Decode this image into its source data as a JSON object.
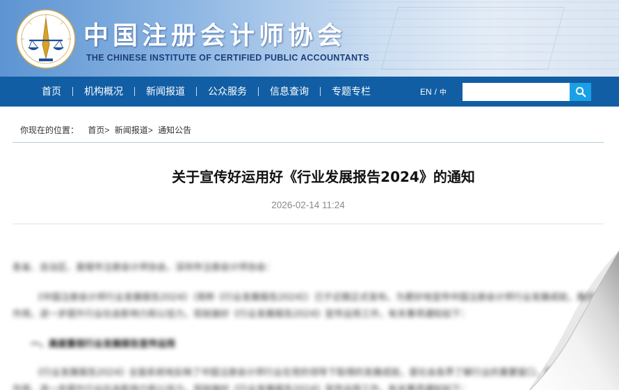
{
  "header": {
    "title_cn": "中国注册会计师协会",
    "title_en": "THE CHINESE INSTITUTE OF CERTIFIED PUBLIC ACCOUNTANTS",
    "emblem_icon": "cicpa-emblem-icon"
  },
  "nav": {
    "items": [
      {
        "label": "首页"
      },
      {
        "label": "机构概况"
      },
      {
        "label": "新闻报道"
      },
      {
        "label": "公众服务"
      },
      {
        "label": "信息查询"
      },
      {
        "label": "专题专栏"
      }
    ],
    "lang_en": "EN",
    "lang_sep": "/",
    "lang_cn": "中",
    "search": {
      "value": "",
      "placeholder": "",
      "icon": "search-icon"
    },
    "background": "#115ea4",
    "search_button_color": "#1aa0e6"
  },
  "breadcrumb": {
    "label": "你现在的位置：",
    "items": [
      "首页>",
      "新闻报道>",
      "通知公告"
    ]
  },
  "article": {
    "title": "关于宣传好运用好《行业发展报告2024》的通知",
    "date": "2026-02-14 11:24",
    "paragraphs": [
      "各省、自治区、直辖市注册会计师协会，深圳市注册会计师协会：",
      "《中国注册会计师行业发展报告2024》（简称《行业发展报告2024》）已于近期正式发布。为更好地宣传中国注册会计师行业发展成就，展示行业服务国家建设的重要",
      "作用，进一步提升行业社会影响力和公信力，现就做好《行业发展报告2024》宣传运用工作，有关事项通知如下：",
      "一、高度重视行业发展报告宣传运用",
      "《行业发展报告2024》全面系统地反映了中国注册会计师行业在党的领导下取得的发展成就，是社会各界了解行业的重要窗口，各地方注协要充分认识做好报告宣传"
    ]
  }
}
